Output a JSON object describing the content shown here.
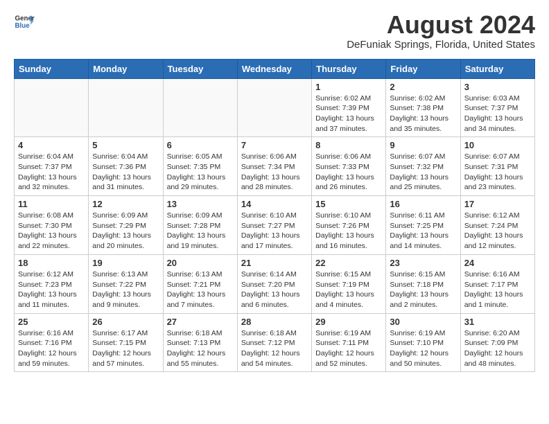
{
  "header": {
    "logo_line1": "General",
    "logo_line2": "Blue",
    "main_title": "August 2024",
    "subtitle": "DeFuniak Springs, Florida, United States"
  },
  "weekdays": [
    "Sunday",
    "Monday",
    "Tuesday",
    "Wednesday",
    "Thursday",
    "Friday",
    "Saturday"
  ],
  "weeks": [
    [
      {
        "day": "",
        "info": ""
      },
      {
        "day": "",
        "info": ""
      },
      {
        "day": "",
        "info": ""
      },
      {
        "day": "",
        "info": ""
      },
      {
        "day": "1",
        "info": "Sunrise: 6:02 AM\nSunset: 7:39 PM\nDaylight: 13 hours\nand 37 minutes."
      },
      {
        "day": "2",
        "info": "Sunrise: 6:02 AM\nSunset: 7:38 PM\nDaylight: 13 hours\nand 35 minutes."
      },
      {
        "day": "3",
        "info": "Sunrise: 6:03 AM\nSunset: 7:37 PM\nDaylight: 13 hours\nand 34 minutes."
      }
    ],
    [
      {
        "day": "4",
        "info": "Sunrise: 6:04 AM\nSunset: 7:37 PM\nDaylight: 13 hours\nand 32 minutes."
      },
      {
        "day": "5",
        "info": "Sunrise: 6:04 AM\nSunset: 7:36 PM\nDaylight: 13 hours\nand 31 minutes."
      },
      {
        "day": "6",
        "info": "Sunrise: 6:05 AM\nSunset: 7:35 PM\nDaylight: 13 hours\nand 29 minutes."
      },
      {
        "day": "7",
        "info": "Sunrise: 6:06 AM\nSunset: 7:34 PM\nDaylight: 13 hours\nand 28 minutes."
      },
      {
        "day": "8",
        "info": "Sunrise: 6:06 AM\nSunset: 7:33 PM\nDaylight: 13 hours\nand 26 minutes."
      },
      {
        "day": "9",
        "info": "Sunrise: 6:07 AM\nSunset: 7:32 PM\nDaylight: 13 hours\nand 25 minutes."
      },
      {
        "day": "10",
        "info": "Sunrise: 6:07 AM\nSunset: 7:31 PM\nDaylight: 13 hours\nand 23 minutes."
      }
    ],
    [
      {
        "day": "11",
        "info": "Sunrise: 6:08 AM\nSunset: 7:30 PM\nDaylight: 13 hours\nand 22 minutes."
      },
      {
        "day": "12",
        "info": "Sunrise: 6:09 AM\nSunset: 7:29 PM\nDaylight: 13 hours\nand 20 minutes."
      },
      {
        "day": "13",
        "info": "Sunrise: 6:09 AM\nSunset: 7:28 PM\nDaylight: 13 hours\nand 19 minutes."
      },
      {
        "day": "14",
        "info": "Sunrise: 6:10 AM\nSunset: 7:27 PM\nDaylight: 13 hours\nand 17 minutes."
      },
      {
        "day": "15",
        "info": "Sunrise: 6:10 AM\nSunset: 7:26 PM\nDaylight: 13 hours\nand 16 minutes."
      },
      {
        "day": "16",
        "info": "Sunrise: 6:11 AM\nSunset: 7:25 PM\nDaylight: 13 hours\nand 14 minutes."
      },
      {
        "day": "17",
        "info": "Sunrise: 6:12 AM\nSunset: 7:24 PM\nDaylight: 13 hours\nand 12 minutes."
      }
    ],
    [
      {
        "day": "18",
        "info": "Sunrise: 6:12 AM\nSunset: 7:23 PM\nDaylight: 13 hours\nand 11 minutes."
      },
      {
        "day": "19",
        "info": "Sunrise: 6:13 AM\nSunset: 7:22 PM\nDaylight: 13 hours\nand 9 minutes."
      },
      {
        "day": "20",
        "info": "Sunrise: 6:13 AM\nSunset: 7:21 PM\nDaylight: 13 hours\nand 7 minutes."
      },
      {
        "day": "21",
        "info": "Sunrise: 6:14 AM\nSunset: 7:20 PM\nDaylight: 13 hours\nand 6 minutes."
      },
      {
        "day": "22",
        "info": "Sunrise: 6:15 AM\nSunset: 7:19 PM\nDaylight: 13 hours\nand 4 minutes."
      },
      {
        "day": "23",
        "info": "Sunrise: 6:15 AM\nSunset: 7:18 PM\nDaylight: 13 hours\nand 2 minutes."
      },
      {
        "day": "24",
        "info": "Sunrise: 6:16 AM\nSunset: 7:17 PM\nDaylight: 13 hours\nand 1 minute."
      }
    ],
    [
      {
        "day": "25",
        "info": "Sunrise: 6:16 AM\nSunset: 7:16 PM\nDaylight: 12 hours\nand 59 minutes."
      },
      {
        "day": "26",
        "info": "Sunrise: 6:17 AM\nSunset: 7:15 PM\nDaylight: 12 hours\nand 57 minutes."
      },
      {
        "day": "27",
        "info": "Sunrise: 6:18 AM\nSunset: 7:13 PM\nDaylight: 12 hours\nand 55 minutes."
      },
      {
        "day": "28",
        "info": "Sunrise: 6:18 AM\nSunset: 7:12 PM\nDaylight: 12 hours\nand 54 minutes."
      },
      {
        "day": "29",
        "info": "Sunrise: 6:19 AM\nSunset: 7:11 PM\nDaylight: 12 hours\nand 52 minutes."
      },
      {
        "day": "30",
        "info": "Sunrise: 6:19 AM\nSunset: 7:10 PM\nDaylight: 12 hours\nand 50 minutes."
      },
      {
        "day": "31",
        "info": "Sunrise: 6:20 AM\nSunset: 7:09 PM\nDaylight: 12 hours\nand 48 minutes."
      }
    ]
  ]
}
